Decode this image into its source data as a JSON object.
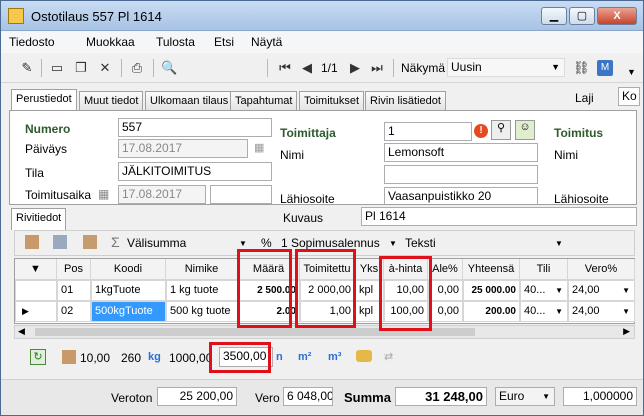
{
  "window": {
    "title": "Ostotilaus 557 Pl 1614",
    "min": "▁",
    "max": "▢",
    "close": "X"
  },
  "menu": [
    "Tiedosto",
    "Muokkaa",
    "Tulosta",
    "Etsi",
    "Näytä"
  ],
  "toolbar": {
    "pager": "1/1",
    "view_label": "Näkymä",
    "view_value": "Uusin",
    "laji": "Laji",
    "ko": "Ko"
  },
  "tabs": [
    "Perustiedot",
    "Muut tiedot",
    "Ulkomaan tilaus",
    "Tapahtumat",
    "Toimitukset",
    "Rivin lisätiedot"
  ],
  "header": {
    "numero_label": "Numero",
    "numero": "557",
    "paivays_label": "Päiväys",
    "paivays": "17.08.2017",
    "tila_label": "Tila",
    "tila": "JÄLKITOIMITUS",
    "toimitusaika_label": "Toimitusaika",
    "toimitusaika": "17.08.2017",
    "toimittaja_label": "Toimittaja",
    "toimittaja": "1",
    "nimi_label": "Nimi",
    "nimi": "Lemonsoft",
    "lahiosoite_label": "Lähiosoite",
    "lahiosoite": "Vaasanpuistikko 20",
    "toimitus_label": "Toimitus",
    "toimitus_nimi_label": "Nimi",
    "toimitus_lahiosoite_label": "Lähiosoite"
  },
  "rows_tab": {
    "label": "Rivitiedot",
    "kuvaus_label": "Kuvaus",
    "kuvaus": "Pl 1614"
  },
  "rows_toolbar": {
    "sigma": "Σ",
    "valisumma": "Välisumma",
    "percent": "%",
    "sopimusalennus": "1 Sopimusalennus",
    "teksti": "Teksti"
  },
  "columns": [
    "Pos",
    "Koodi",
    "Nimike",
    "Määrä",
    "Toimitettu",
    "Yks",
    "à-hinta",
    "Ale%",
    "Yhteensä",
    "Tili",
    "Vero%"
  ],
  "rows": [
    {
      "pos": "01",
      "koodi": "1kgTuote",
      "nimike": "1 kg tuote",
      "maara": "2 500.00",
      "toimitettu": "2 000,00",
      "yks": "kpl",
      "ahinta": "10,00",
      "ale": "0,00",
      "yhteensa": "25 000.00",
      "tili": "40...",
      "vero": "24,00"
    },
    {
      "pos": "02",
      "koodi": "500kgTuote",
      "nimike": "500 kg tuote",
      "maara": "2.00",
      "toimitettu": "1,00",
      "yks": "kpl",
      "ahinta": "100,00",
      "ale": "0,00",
      "yhteensa": "200.00",
      "tili": "40...",
      "vero": "24,00"
    }
  ],
  "footer_stats": {
    "a": "10,00",
    "b": "260",
    "kg_label": "kg",
    "kg": "1000,00",
    "c": "3500,00",
    "m2": "m²",
    "m3": "m³",
    "n": "n"
  },
  "totals": {
    "veroton_label": "Veroton",
    "veroton": "25 200,00",
    "vero_label": "Vero",
    "vero": "6 048,00",
    "summa_label": "Summa",
    "summa": "31 248,00",
    "currency": "Euro",
    "rate": "1,000000"
  },
  "colors": {
    "highlight_red": "#e0101a",
    "selection_blue": "#3399ff"
  }
}
